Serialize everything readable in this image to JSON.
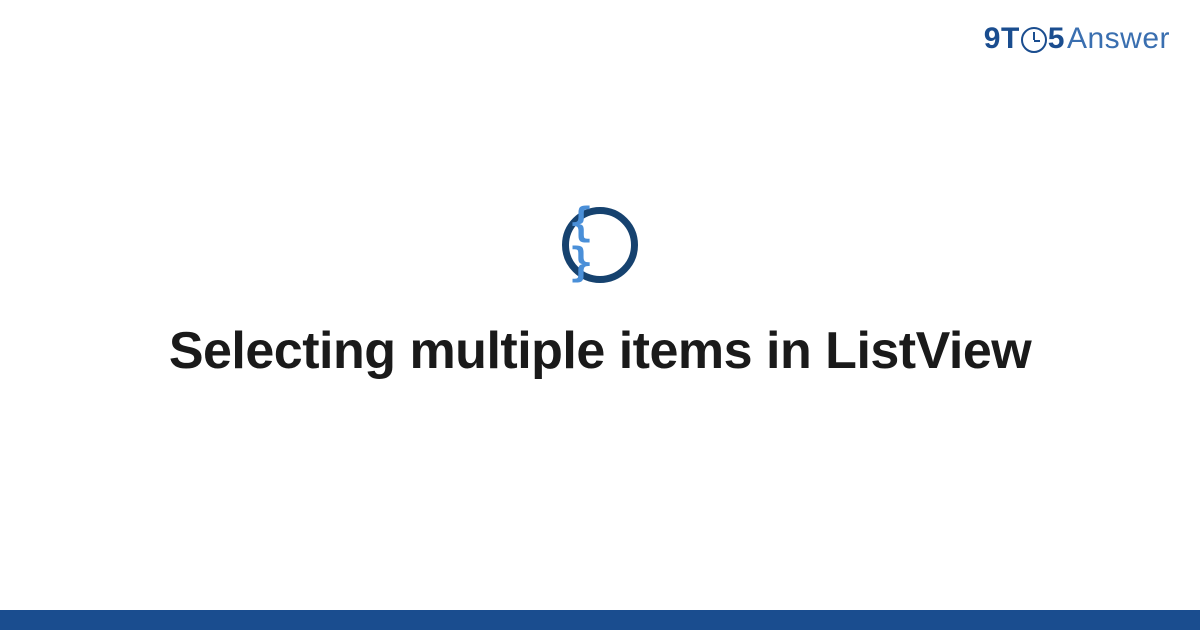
{
  "logo": {
    "part_nine": "9",
    "part_t": "T",
    "part_five": "5",
    "part_answer": "Answer"
  },
  "icon": {
    "braces": "{ }",
    "name": "code-braces-icon"
  },
  "title": "Selecting multiple items in ListView",
  "colors": {
    "brand_dark": "#16426f",
    "brand_blue": "#1a4d8f",
    "brand_light": "#4a8fd8",
    "text": "#1a1a1a"
  }
}
